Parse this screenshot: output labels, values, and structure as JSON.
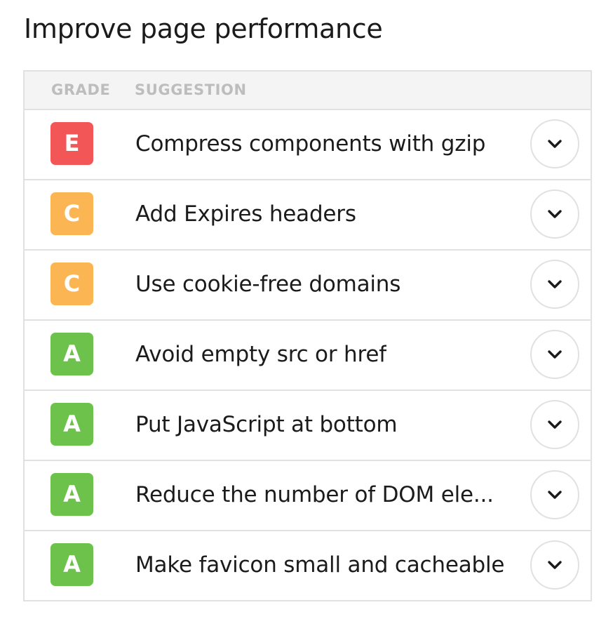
{
  "title": "Improve page performance",
  "table": {
    "columns": {
      "grade": "GRADE",
      "suggestion": "SUGGESTION"
    },
    "rows": [
      {
        "grade": "E",
        "grade_color": "#f25656",
        "suggestion": "Compress components with gzip"
      },
      {
        "grade": "C",
        "grade_color": "#fcb553",
        "suggestion": "Add Expires headers"
      },
      {
        "grade": "C",
        "grade_color": "#fcb553",
        "suggestion": "Use cookie-free domains"
      },
      {
        "grade": "A",
        "grade_color": "#6cc24a",
        "suggestion": "Avoid empty src or href"
      },
      {
        "grade": "A",
        "grade_color": "#6cc24a",
        "suggestion": "Put JavaScript at bottom"
      },
      {
        "grade": "A",
        "grade_color": "#6cc24a",
        "suggestion": "Reduce the number of DOM ele..."
      },
      {
        "grade": "A",
        "grade_color": "#6cc24a",
        "suggestion": "Make favicon small and cacheable"
      }
    ],
    "expand_icon": "chevron-down-icon"
  }
}
